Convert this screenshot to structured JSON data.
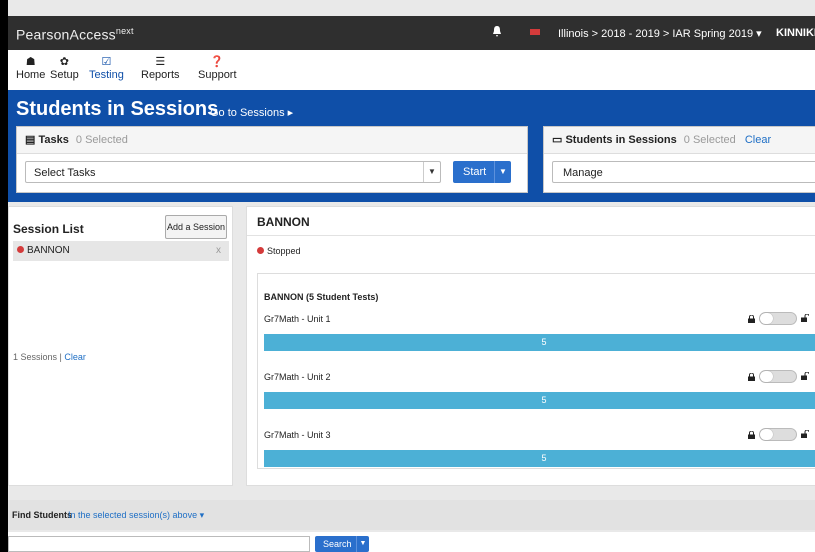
{
  "app": {
    "brand": "PearsonAccess",
    "brand_sup": "next"
  },
  "header": {
    "context": "Illinois > 2018 - 2019 > IAR Spring 2019 ▾",
    "user": "KINNIKIN",
    "flag_color": "#d43b3b"
  },
  "nav": [
    {
      "label": "Home",
      "icon": "home-icon"
    },
    {
      "label": "Setup",
      "icon": "gear-icon"
    },
    {
      "label": "Testing",
      "icon": "checkbox-icon",
      "active": true
    },
    {
      "label": "Reports",
      "icon": "report-icon"
    },
    {
      "label": "Support",
      "icon": "help-icon"
    }
  ],
  "banner": {
    "title": "Students in Sessions",
    "goto": "Go to Sessions ▸",
    "color": "#0f4fa8"
  },
  "tasks": {
    "title": "Tasks",
    "selected": "0 Selected",
    "select_placeholder": "Select Tasks",
    "start": "Start"
  },
  "sis": {
    "title": "Students in Sessions",
    "selected": "0 Selected",
    "clear": "Clear",
    "manage": "Manage"
  },
  "sessions": {
    "title": "Session List",
    "add_button": "Add a Session",
    "items": [
      {
        "name": "BANNON",
        "close": "x"
      }
    ],
    "count": "1 Sessions |",
    "clear": "Clear"
  },
  "detail": {
    "name": "BANNON",
    "status": "Stopped",
    "tests_header": "BANNON (5 Student Tests)",
    "units": [
      {
        "name": "Gr7Math - Unit 1",
        "count": "5"
      },
      {
        "name": "Gr7Math - Unit 2",
        "count": "5"
      },
      {
        "name": "Gr7Math - Unit 3",
        "count": "5"
      }
    ]
  },
  "find": {
    "label": "Find Students",
    "scope": "In the selected session(s) above ▾",
    "search": "Search"
  }
}
